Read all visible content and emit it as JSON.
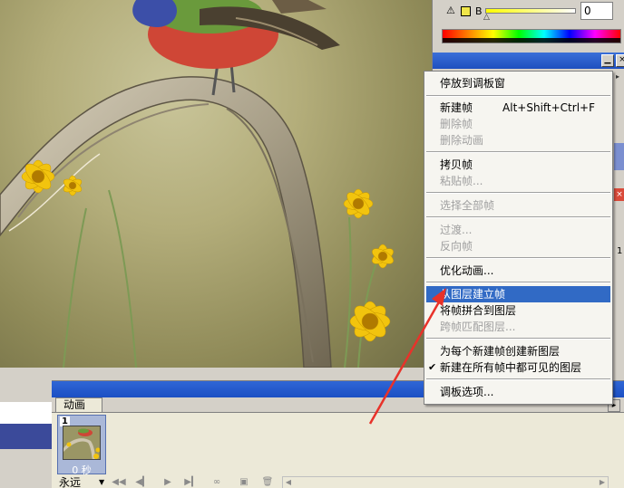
{
  "color_panel": {
    "warning_icon": "warning-triangle-icon",
    "channel_label": "B",
    "channel_value": "0",
    "swatch_color": "#f0e64a"
  },
  "menu": {
    "items": [
      {
        "label": "停放到调板窗",
        "disabled": false
      },
      {
        "label": "新建帧",
        "shortcut": "Alt+Shift+Ctrl+F",
        "disabled": false
      },
      {
        "label": "删除帧",
        "disabled": true
      },
      {
        "label": "删除动画",
        "disabled": true
      },
      {
        "label": "拷贝帧",
        "disabled": false
      },
      {
        "label": "粘贴帧...",
        "disabled": true
      },
      {
        "label": "选择全部帧",
        "disabled": true
      },
      {
        "label": "过渡...",
        "disabled": true
      },
      {
        "label": "反向帧",
        "disabled": true
      },
      {
        "label": "优化动画...",
        "disabled": false
      },
      {
        "label": "从图层建立帧",
        "disabled": false,
        "highlighted": true
      },
      {
        "label": "将帧拼合到图层",
        "disabled": false
      },
      {
        "label": "跨帧匹配图层...",
        "disabled": true
      },
      {
        "label": "为每个新建帧创建新图层",
        "disabled": false
      },
      {
        "label": "新建在所有帧中都可见的图层",
        "disabled": false,
        "checked": true
      },
      {
        "label": "调板选项...",
        "disabled": false
      }
    ]
  },
  "animation_panel": {
    "tab_label": "动画",
    "frame_number": "1",
    "frame_time": "0 秒",
    "loop_label": "永远"
  },
  "side": {
    "num": "1"
  }
}
